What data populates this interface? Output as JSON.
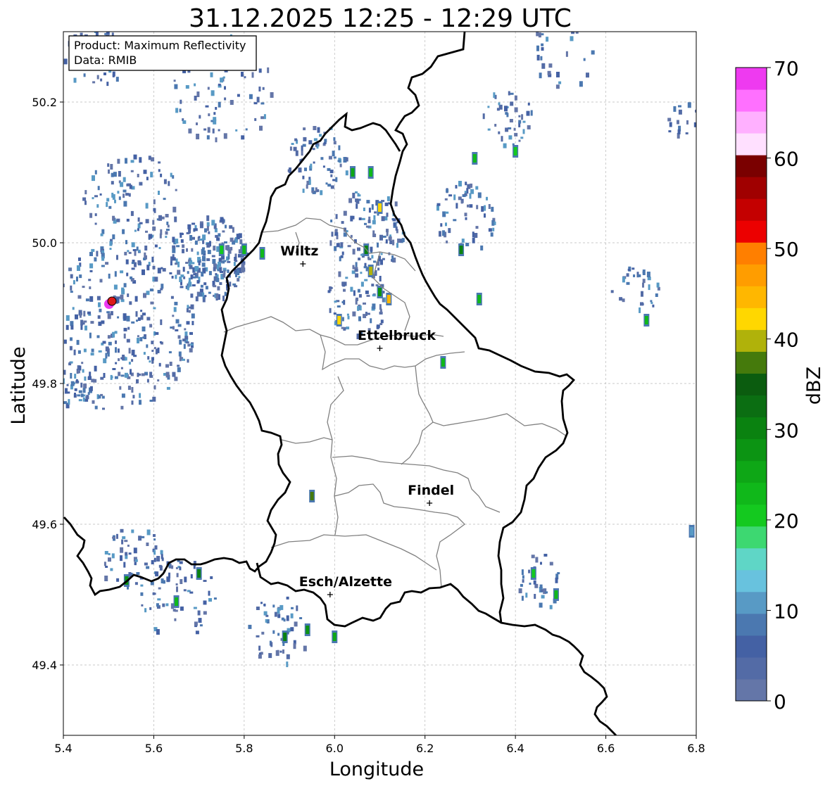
{
  "title": "31.12.2025 12:25 - 12:29 UTC",
  "info_box": {
    "line1": "Product: Maximum Reflectivity",
    "line2": "Data: RMIB"
  },
  "axes": {
    "xlabel": "Longitude",
    "ylabel": "Latitude",
    "xlim": [
      5.4,
      6.8
    ],
    "ylim": [
      49.3,
      50.3
    ],
    "xticks": [
      5.4,
      5.6,
      5.8,
      6.0,
      6.2,
      6.4,
      6.6,
      6.8
    ],
    "xtick_labels": [
      "5.4",
      "5.6",
      "5.8",
      "6.0",
      "6.2",
      "6.4",
      "6.6",
      "6.8"
    ],
    "yticks": [
      49.4,
      49.6,
      49.8,
      50.0,
      50.2
    ],
    "ytick_labels": [
      "49.4",
      "49.6",
      "49.8",
      "50.0",
      "50.2"
    ],
    "grid": true
  },
  "colorbar": {
    "label": "dBZ",
    "min": 0,
    "max": 70,
    "ticks": [
      0,
      10,
      20,
      30,
      40,
      50,
      60,
      70
    ],
    "tick_labels": [
      "0",
      "10",
      "20",
      "30",
      "40",
      "50",
      "60",
      "70"
    ],
    "colors": [
      "#6476a8",
      "#536ba6",
      "#4461a4",
      "#4b78b0",
      "#589ac5",
      "#68c2de",
      "#5fd6c6",
      "#3dd871",
      "#14c91f",
      "#10b81a",
      "#0ea716",
      "#0c9413",
      "#0a8210",
      "#0b6e12",
      "#0b5c0f",
      "#457a0c",
      "#b0b20a",
      "#ffd700",
      "#ffb700",
      "#ff9d00",
      "#ff7f00",
      "#ec0000",
      "#c40000",
      "#a00000",
      "#7a0000",
      "#ffe0ff",
      "#ffb0ff",
      "#ff70ff",
      "#ee3af0"
    ]
  },
  "places": [
    {
      "name": "Wiltz",
      "lon": 5.93,
      "lat": 49.97
    },
    {
      "name": "Ettelbruck",
      "lon": 6.1,
      "lat": 49.85
    },
    {
      "name": "Findel",
      "lon": 6.21,
      "lat": 49.63
    },
    {
      "name": "Esch/Alzette",
      "lon": 5.99,
      "lat": 49.5
    }
  ],
  "radar_site": {
    "lon": 5.505,
    "lat": 49.915
  },
  "chart_data": {
    "type": "heatmap",
    "title": "31.12.2025 12:25 - 12:29 UTC",
    "xlabel": "Longitude",
    "ylabel": "Latitude",
    "xlim": [
      5.4,
      6.8
    ],
    "ylim": [
      49.3,
      50.3
    ],
    "value_label": "dBZ",
    "value_range": [
      0,
      70
    ],
    "echo_cells": [
      {
        "lon": 5.45,
        "lat": 50.28,
        "dbz": 5
      },
      {
        "lon": 5.75,
        "lat": 49.99,
        "dbz": 20
      },
      {
        "lon": 5.8,
        "lat": 49.99,
        "dbz": 22
      },
      {
        "lon": 5.84,
        "lat": 49.985,
        "dbz": 24
      },
      {
        "lon": 6.04,
        "lat": 50.1,
        "dbz": 26
      },
      {
        "lon": 6.08,
        "lat": 50.1,
        "dbz": 24
      },
      {
        "lon": 6.1,
        "lat": 50.05,
        "dbz": 42
      },
      {
        "lon": 6.07,
        "lat": 49.99,
        "dbz": 30
      },
      {
        "lon": 6.08,
        "lat": 49.96,
        "dbz": 40
      },
      {
        "lon": 6.01,
        "lat": 49.89,
        "dbz": 42
      },
      {
        "lon": 6.12,
        "lat": 49.92,
        "dbz": 44
      },
      {
        "lon": 6.1,
        "lat": 49.93,
        "dbz": 28
      },
      {
        "lon": 6.28,
        "lat": 49.99,
        "dbz": 30
      },
      {
        "lon": 6.32,
        "lat": 49.92,
        "dbz": 24
      },
      {
        "lon": 6.31,
        "lat": 50.12,
        "dbz": 24
      },
      {
        "lon": 6.4,
        "lat": 50.13,
        "dbz": 20
      },
      {
        "lon": 6.24,
        "lat": 49.83,
        "dbz": 24
      },
      {
        "lon": 6.69,
        "lat": 49.89,
        "dbz": 24
      },
      {
        "lon": 5.95,
        "lat": 49.64,
        "dbz": 38
      },
      {
        "lon": 6.44,
        "lat": 49.53,
        "dbz": 20
      },
      {
        "lon": 6.49,
        "lat": 49.5,
        "dbz": 22
      },
      {
        "lon": 5.65,
        "lat": 49.49,
        "dbz": 24
      },
      {
        "lon": 5.7,
        "lat": 49.53,
        "dbz": 30
      },
      {
        "lon": 5.54,
        "lat": 49.52,
        "dbz": 28
      },
      {
        "lon": 5.89,
        "lat": 49.44,
        "dbz": 30
      },
      {
        "lon": 5.94,
        "lat": 49.45,
        "dbz": 28
      },
      {
        "lon": 6.0,
        "lat": 49.44,
        "dbz": 26
      },
      {
        "lon": 6.79,
        "lat": 49.59,
        "dbz": 12
      }
    ]
  }
}
